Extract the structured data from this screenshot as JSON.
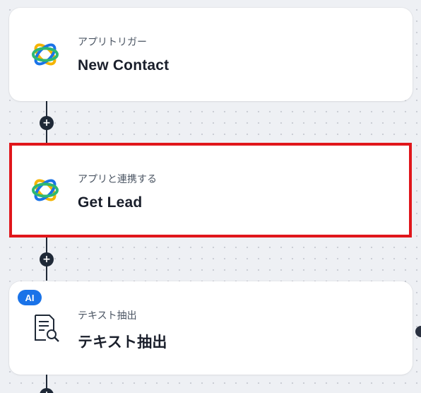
{
  "flow": {
    "steps": [
      {
        "subtitle": "アプリトリガー",
        "title": "New Contact",
        "icon": "app-orbit-icon"
      },
      {
        "subtitle": "アプリと連携する",
        "title": "Get Lead",
        "icon": "app-orbit-icon"
      },
      {
        "subtitle": "テキスト抽出",
        "title": "テキスト抽出",
        "icon": "document-search-icon",
        "badge": "AI"
      }
    ],
    "add_step_symbol": "+"
  },
  "colors": {
    "highlight_border": "#e0161b",
    "ai_badge": "#1a73e8",
    "connector": "#1f2937"
  }
}
